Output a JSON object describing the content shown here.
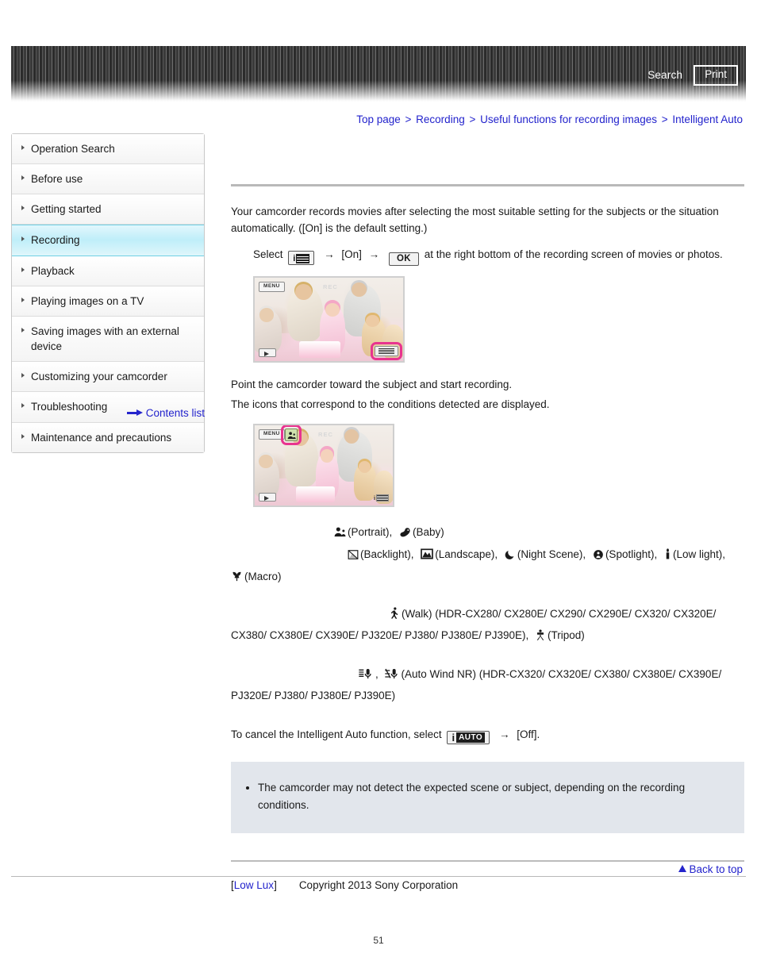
{
  "header": {
    "search_label": "Search",
    "print_label": "Print"
  },
  "breadcrumb": {
    "items": [
      {
        "label": "Top page"
      },
      {
        "label": "Recording"
      },
      {
        "label": "Useful functions for recording images"
      },
      {
        "label": "Intelligent Auto"
      }
    ],
    "separator": ">"
  },
  "sidebar": {
    "items": [
      {
        "label": "Operation Search",
        "active": false
      },
      {
        "label": "Before use",
        "active": false
      },
      {
        "label": "Getting started",
        "active": false
      },
      {
        "label": "Recording",
        "active": true
      },
      {
        "label": "Playback",
        "active": false
      },
      {
        "label": "Playing images on a TV",
        "active": false
      },
      {
        "label": "Saving images with an external device",
        "active": false
      },
      {
        "label": "Customizing your camcorder",
        "active": false
      },
      {
        "label": "Troubleshooting",
        "active": false
      },
      {
        "label": "Maintenance and precautions",
        "active": false
      }
    ],
    "contents_list_label": "Contents list",
    "active_color": "#bfeef9"
  },
  "main": {
    "intro": "Your camcorder records movies after selecting the most suitable setting for the subjects or the situation automatically. ([On] is the default setting.)",
    "select_prefix": "Select",
    "select_on": "[On]",
    "select_ok": "OK",
    "select_suffix": "at the right bottom of the recording screen of movies or photos.",
    "point_line1": "Point the camcorder toward the subject and start recording.",
    "point_line2": "The icons that correspond to the conditions detected are displayed.",
    "screenshot1": {
      "menu_label": "MENU",
      "rec_label": "REC",
      "highlight_color": "#e8348f"
    },
    "screenshot2": {
      "menu_label": "MENU",
      "rec_label": "REC",
      "highlight_color": "#e8348f"
    },
    "scenes": {
      "row1": "(Portrait),",
      "row1b": "(Baby)",
      "row2a": "(Backlight),",
      "row2b": "(Landscape),",
      "row2c": "(Night Scene),",
      "row2d": "(Spotlight),",
      "row2e": "(Low light),",
      "row3": "(Macro)",
      "walk_label": "(Walk) (HDR-CX280/ CX280E/ CX290/ CX290E/ CX320/ CX320E/",
      "walk_cont": "CX380/ CX380E/ CX390E/ PJ320E/ PJ380/ PJ380E/ PJ390E),",
      "tripod_label": "(Tripod)",
      "windnr_label": "(Auto Wind NR) (HDR-CX320/ CX320E/ CX380/ CX380E/ CX390E/",
      "windnr_cont": "PJ320E/ PJ380/ PJ380E/ PJ390E)"
    },
    "cancel_prefix": "To cancel the Intelligent Auto function, select",
    "cancel_i": "i",
    "cancel_auto": "AUTO",
    "cancel_suffix": "[Off].",
    "note": "The camcorder may not detect the expected scene or subject, depending on the recording conditions.",
    "lowlux_bracket_open": "[",
    "lowlux_label": "Low Lux",
    "lowlux_bracket_close": "]"
  },
  "footer": {
    "back_to_top_label": "Back to top",
    "copyright": "Copyright 2013 Sony Corporation",
    "page_number": "51"
  }
}
